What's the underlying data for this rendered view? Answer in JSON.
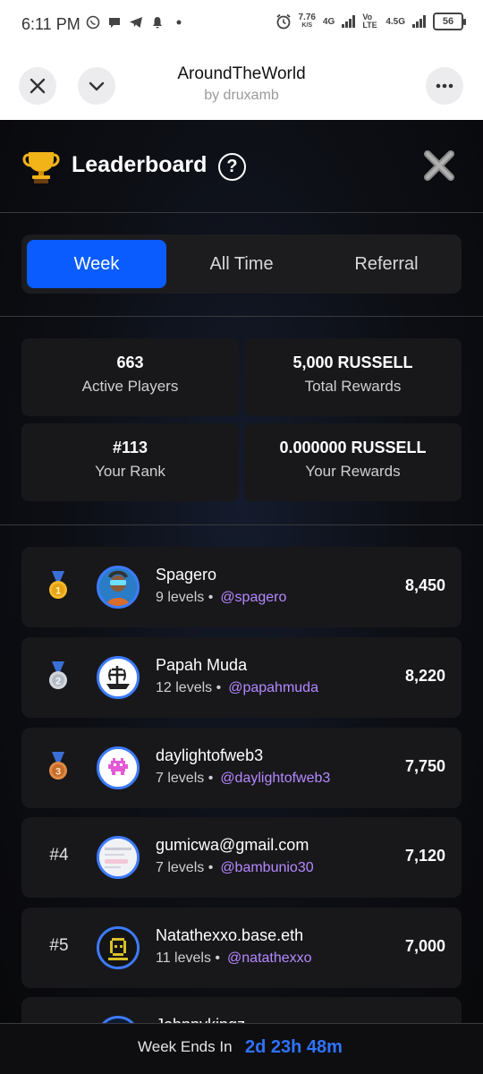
{
  "status": {
    "time": "6:11 PM",
    "speed_value": "7.76",
    "speed_unit": "K/S",
    "net1": "4G",
    "volte": "Vo LTE",
    "net2": "4.5G",
    "battery": "56"
  },
  "app": {
    "title": "AroundTheWorld",
    "subtitle": "by druxamb"
  },
  "leaderboard": {
    "title": "Leaderboard",
    "help": "?",
    "tabs": [
      {
        "label": "Week",
        "active": true
      },
      {
        "label": "All Time"
      },
      {
        "label": "Referral"
      }
    ],
    "stats": [
      {
        "value": "663",
        "label": "Active Players"
      },
      {
        "value": "5,000 RUSSELL",
        "label": "Total Rewards"
      },
      {
        "value": "#113",
        "label": "Your Rank"
      },
      {
        "value": "0.000000 RUSSELL",
        "label": "Your Rewards"
      }
    ],
    "players": [
      {
        "medal": "gold",
        "medal_num": "1",
        "name": "Spagero",
        "levels": "9 levels",
        "handle": "@spagero",
        "score": "8,450"
      },
      {
        "medal": "silver",
        "medal_num": "2",
        "name": "Papah Muda",
        "levels": "12 levels",
        "handle": "@papahmuda",
        "score": "8,220"
      },
      {
        "medal": "bronze",
        "medal_num": "3",
        "name": "daylightofweb3",
        "levels": "7 levels",
        "handle": "@daylightofweb3",
        "score": "7,750"
      },
      {
        "rank": "#4",
        "name": "gumicwa@gmail.com",
        "levels": "7 levels",
        "handle": "@bambunio30",
        "score": "7,120"
      },
      {
        "rank": "#5",
        "name": "Natathexxo.base.eth",
        "levels": "11 levels",
        "handle": "@natathexxo",
        "score": "7,000"
      },
      {
        "name": "Johnnykingz"
      }
    ],
    "separator": "•",
    "footer": {
      "label": "Week Ends In",
      "time": "2d 23h 48m"
    }
  },
  "colors": {
    "accent": "#0a5cff",
    "handle": "#b689ff",
    "countdown": "#2f73ff"
  }
}
